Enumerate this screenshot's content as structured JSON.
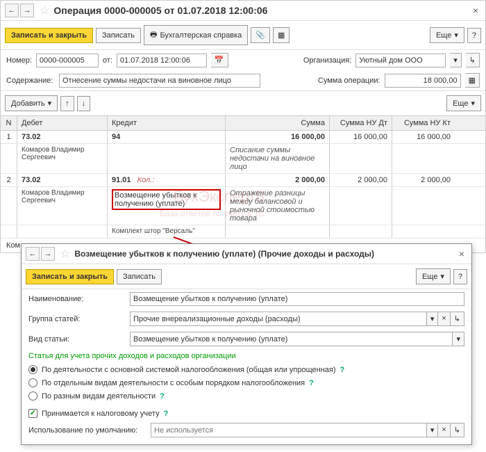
{
  "main": {
    "title": "Операция 0000-000005 от 01.07.2018 12:00:06",
    "save_close": "Записать и закрыть",
    "save": "Записать",
    "buh_help": "Бухгалтерская справка",
    "more": "Еще",
    "number_lbl": "Номер:",
    "number_val": "0000-000005",
    "from_lbl": "от:",
    "date_val": "01.07.2018 12:00:06",
    "org_lbl": "Организация:",
    "org_val": "Уютный дом ООО",
    "content_lbl": "Содержание:",
    "content_val": "Отнесение суммы недостачи на виновное лицо",
    "sum_lbl": "Сумма операции:",
    "sum_val": "18 000,00",
    "add_btn": "Добавить"
  },
  "grid": {
    "h_n": "N",
    "h_debet": "Дебет",
    "h_kredit": "Кредит",
    "h_sum": "Сумма",
    "h_nud": "Сумма НУ Дт",
    "h_nuk": "Сумма НУ Кт",
    "rows": [
      {
        "n": "1",
        "deb_acc": "73.02",
        "deb_sub": "Комаров Владимир Сергеевич",
        "kre_acc": "94",
        "kre_sub": "",
        "sum": "16 000,00",
        "nud": "16 000,00",
        "nuk": "16 000,00",
        "desc": "Списание суммы недостачи на виновное лицо"
      },
      {
        "n": "2",
        "deb_acc": "73.02",
        "deb_sub": "Комаров Владимир Сергеевич",
        "kre_acc": "91.01",
        "kre_kol": "Кол.:",
        "kre_sub1": "Возмещение убытков к получению (уплате)",
        "kre_sub2": "Комплект штор \"Версаль\"",
        "sum": "2 000,00",
        "nud": "2 000,00",
        "nuk": "2 000,00",
        "desc": "Отражение разницы между балансовой и рыночной стоимостью товара"
      }
    ]
  },
  "dialog": {
    "title": "Возмещение убытков к получению (уплате) (Прочие доходы и расходы)",
    "save_close": "Записать и закрыть",
    "save": "Записать",
    "more": "Еще",
    "name_lbl": "Наименование:",
    "name_val": "Возмещение убытков к получению (уплате)",
    "group_lbl": "Группа статей:",
    "group_val": "Прочие внереализационные доходы (расходы)",
    "kind_lbl": "Вид статьи:",
    "kind_val": "Возмещение убытков к получению (уплате)",
    "section": "Статья для учета прочих доходов и расходов организации",
    "r1": "По деятельности с основной системой налогообложения (общая или упрощенная)",
    "r2": "По отдельным видам деятельности с особым порядком налогообложения",
    "r3": "По разным видам деятельности",
    "chk": "Принимается к налоговому учету",
    "def_lbl": "Использование по умолчанию:",
    "def_ph": "Не используется"
  },
  "wm1": "БухЭксперт8",
  "wm2": "База ответов по учету в 1С",
  "truncated": "Ком"
}
